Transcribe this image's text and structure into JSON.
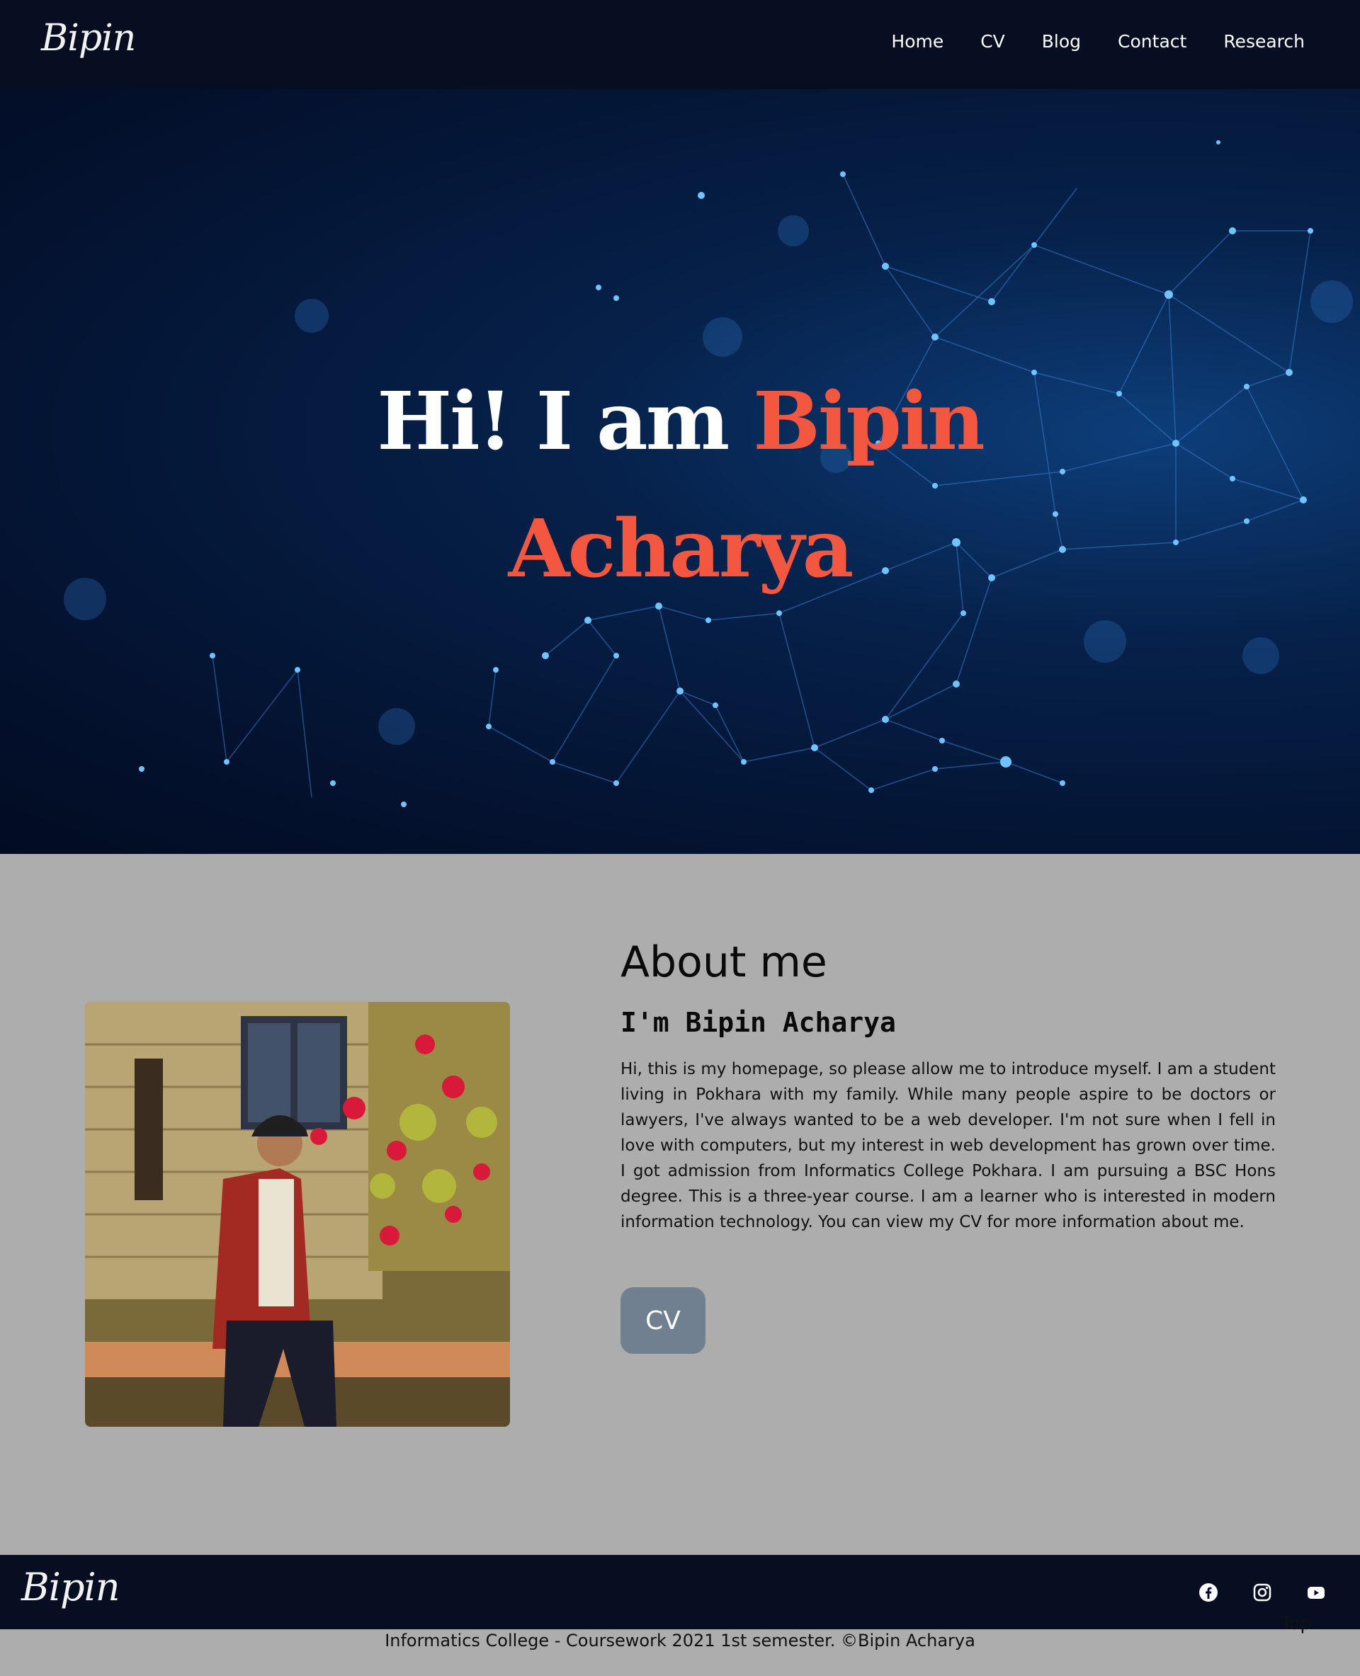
{
  "brand": {
    "logo": "Bipin"
  },
  "nav": {
    "items": [
      "Home",
      "CV",
      "Blog",
      "Contact",
      "Research"
    ]
  },
  "hero": {
    "greeting": "Hi! I am ",
    "first_name": "Bipin",
    "last_name": "Acharya"
  },
  "about": {
    "heading": "About me",
    "subheading": "I'm Bipin Acharya",
    "body": "Hi, this is my homepage, so please allow me to introduce myself. I am a student living in Pokhara with my family. While many people aspire to be doctors or lawyers, I've always wanted to be a web developer. I'm not sure when I fell in love with computers, but my interest in web development has grown over time. I got admission from Informatics College Pokhara. I am pursuing a BSC Hons degree. This is a three-year course. I am a learner who is interested in modern information technology. You can view my CV for more information about me.",
    "cv_button": "CV"
  },
  "footer": {
    "logo": "Bipin",
    "social_icons": [
      "facebook-icon",
      "instagram-icon",
      "youtube-icon"
    ],
    "copyright": "Informatics College - Coursework 2021 1st semester. ©Bipin Acharya",
    "top_link": "Top"
  },
  "colors": {
    "accent": "#f4573f",
    "navbar": "#080e22",
    "about_bg": "#adadad",
    "cv_button": "#708090"
  }
}
